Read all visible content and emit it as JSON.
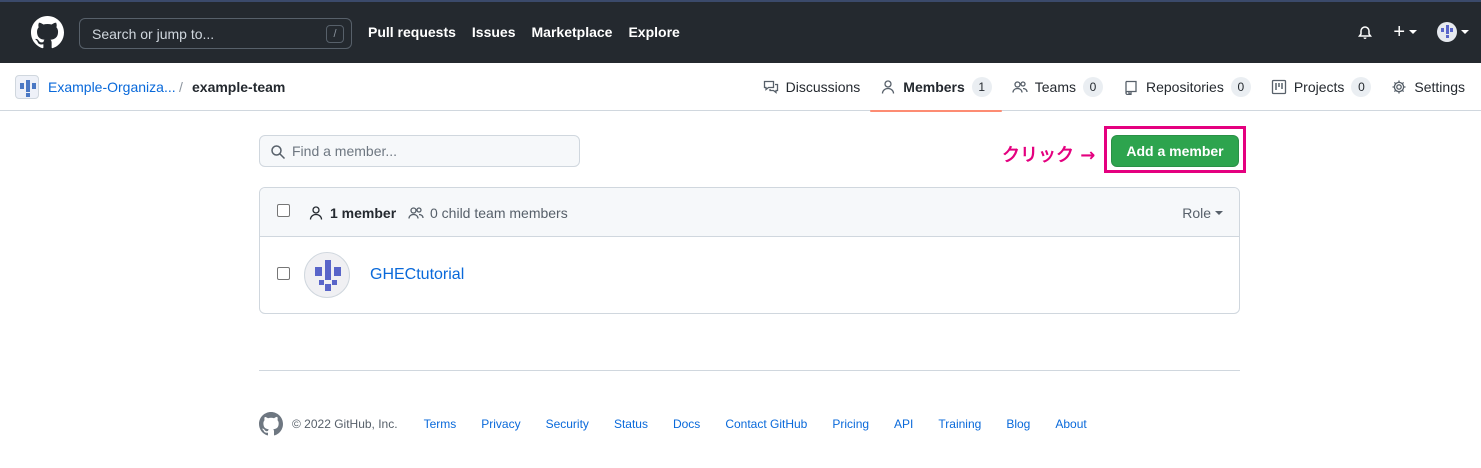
{
  "header": {
    "search_placeholder": "Search or jump to...",
    "search_shortcut": "/",
    "nav": [
      "Pull requests",
      "Issues",
      "Marketplace",
      "Explore"
    ]
  },
  "breadcrumb": {
    "org": "Example-Organiza...",
    "separator": "/",
    "team": "example-team"
  },
  "tabs": [
    {
      "label": "Discussions",
      "icon": "comment-discussion-icon"
    },
    {
      "label": "Members",
      "icon": "person-icon",
      "count": "1",
      "selected": true
    },
    {
      "label": "Teams",
      "icon": "people-icon",
      "count": "0"
    },
    {
      "label": "Repositories",
      "icon": "repo-icon",
      "count": "0"
    },
    {
      "label": "Projects",
      "icon": "project-icon",
      "count": "0"
    },
    {
      "label": "Settings",
      "icon": "gear-icon"
    }
  ],
  "members": {
    "find_placeholder": "Find a member...",
    "add_button": "Add a member",
    "annotation": "クリック →",
    "member_count": "1 member",
    "child_team_count": "0 child team members",
    "role_label": "Role",
    "rows": [
      {
        "name": "GHECtutorial"
      }
    ]
  },
  "footer": {
    "copyright": "© 2022 GitHub, Inc.",
    "links": [
      "Terms",
      "Privacy",
      "Security",
      "Status",
      "Docs",
      "Contact GitHub",
      "Pricing",
      "API",
      "Training",
      "Blog",
      "About"
    ]
  },
  "colors": {
    "header_bg": "#24292f",
    "primary_button": "#2da44e",
    "annotation": "#e4007f",
    "link": "#0969da"
  }
}
